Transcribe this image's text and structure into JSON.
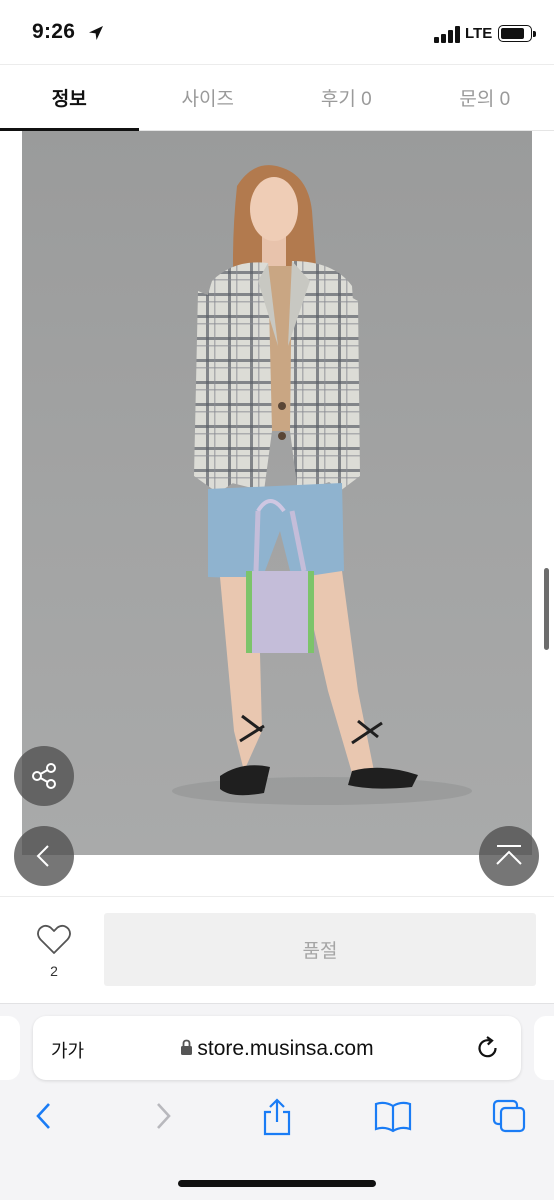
{
  "status_bar": {
    "time": "9:26",
    "network": "LTE",
    "battery_level": 0.85
  },
  "tabs": [
    {
      "label": "정보",
      "active": true
    },
    {
      "label": "사이즈",
      "active": false
    },
    {
      "label": "후기 0",
      "active": false
    },
    {
      "label": "문의 0",
      "active": false
    }
  ],
  "product": {
    "likes": "2",
    "buy_button_label": "품절"
  },
  "browser": {
    "text_size_label": "가가",
    "url": "store.musinsa.com"
  },
  "icons": {
    "share": "share-icon",
    "prev": "chevron-left-icon",
    "scroll_top": "scroll-to-top-icon",
    "like": "heart-icon",
    "lock": "lock-icon",
    "reload": "reload-icon",
    "back": "back-icon",
    "forward": "forward-icon",
    "share_sheet": "share-sheet-icon",
    "bookmarks": "bookmarks-icon",
    "tabs": "tabs-icon"
  },
  "colors": {
    "accent": "#1a7cf5",
    "disabled": "#a5a5a5",
    "button_bg": "#f0f0f0"
  }
}
